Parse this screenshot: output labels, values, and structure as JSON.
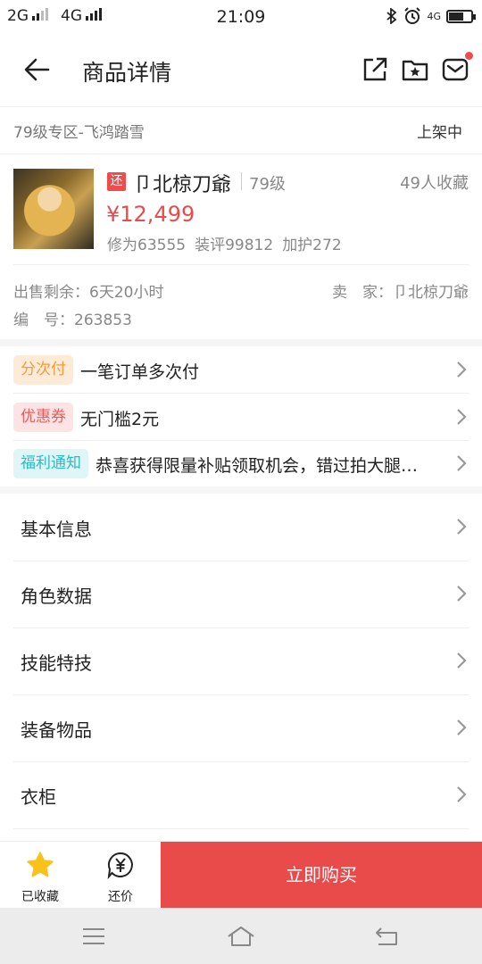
{
  "status_bar": {
    "sim1": "2G",
    "sim2": "4G",
    "time": "21:09",
    "net_badge": "4G",
    "battery_percent": 65
  },
  "header": {
    "title": "商品详情",
    "icons": [
      "back-arrow-icon",
      "share-icon",
      "folder-star-icon",
      "mail-icon"
    ]
  },
  "item": {
    "zone": "79级专区-飞鸿踏雪",
    "listing_status": "上架中",
    "tag": "还",
    "name": "卩北椋刀爺",
    "level": "79级",
    "favorites": "49人收藏",
    "price": "¥12,499",
    "stats": [
      "修为63555",
      "装评99812",
      "加护272"
    ],
    "remain": "出售剩余：6天20小时",
    "seller": "卖　家：卩北椋刀爺",
    "serial": "编　号：263853"
  },
  "promos": [
    {
      "badge": "分次付",
      "text": "一笔订单多次付",
      "color": "#f49a3a",
      "bg": "#fdebd8"
    },
    {
      "badge": "优惠券",
      "text": "无门槛2元",
      "color": "#ec5b5b",
      "bg": "#fde3e3"
    },
    {
      "badge": "福利通知",
      "text": "恭喜获得限量补贴领取机会，错过拍大腿…",
      "color": "#2fb9c2",
      "bg": "#dff5f6"
    }
  ],
  "sections": [
    "基本信息",
    "角色数据",
    "技能特技",
    "装备物品",
    "衣柜"
  ],
  "actions": {
    "favorite_label": "已收藏",
    "bargain_label": "还价",
    "buy_label": "立即购买"
  },
  "colors": {
    "accent": "#e94a4a",
    "star": "#f8c21a"
  }
}
